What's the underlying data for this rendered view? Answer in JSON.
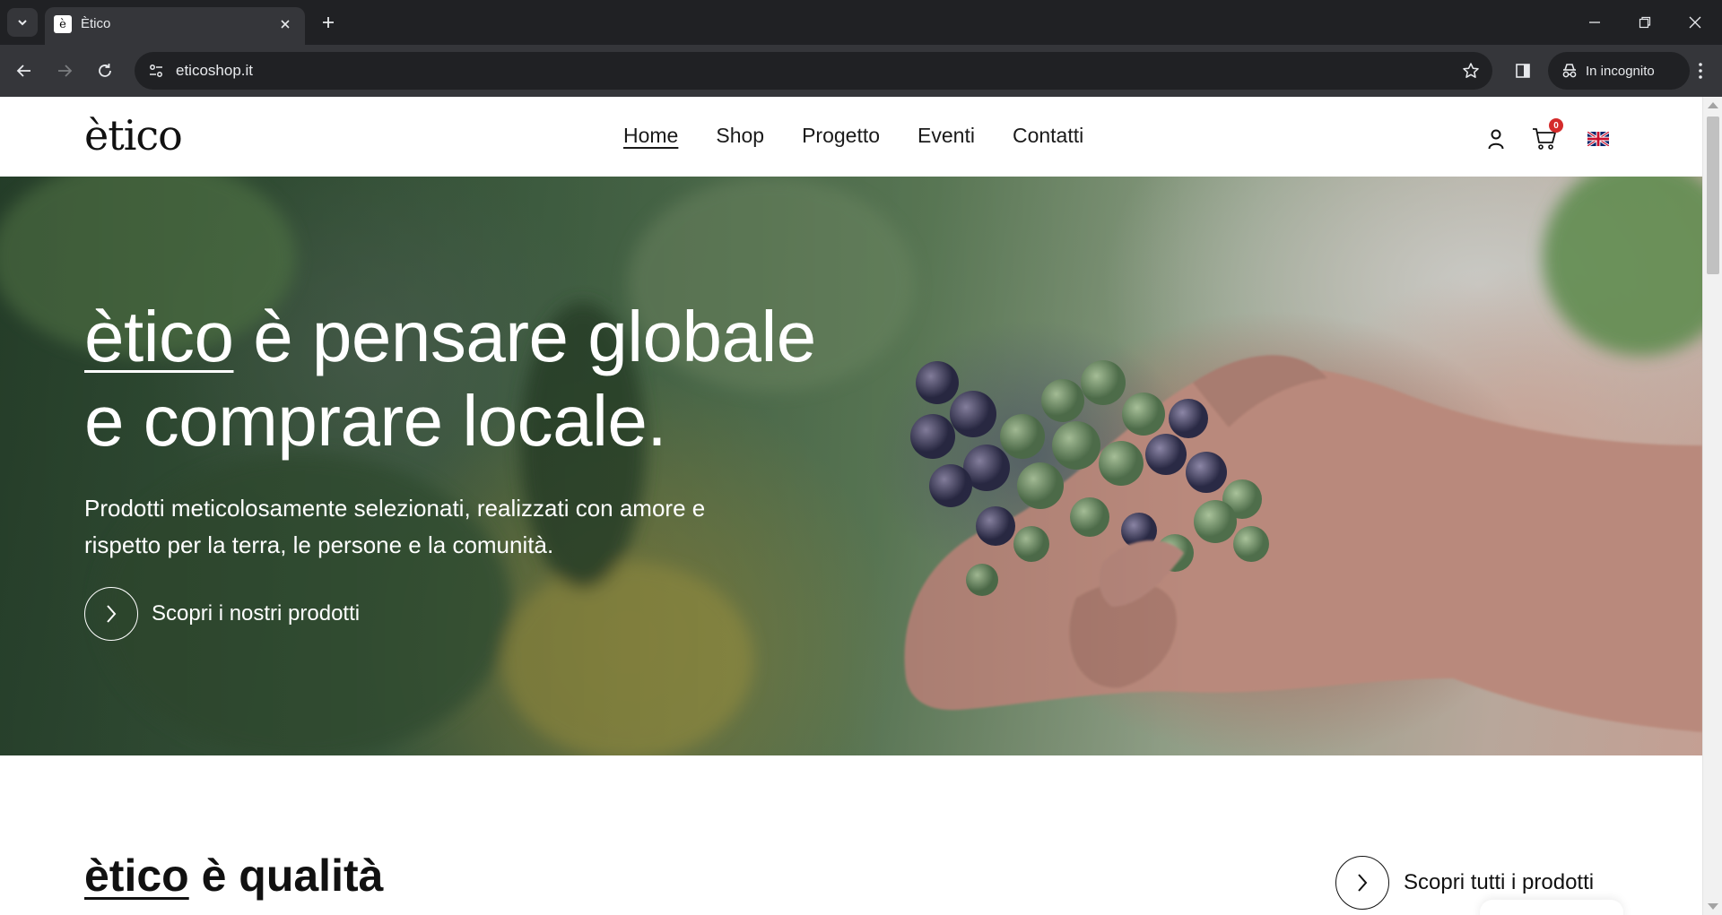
{
  "browser": {
    "tab_title": "Ètico",
    "tab_favicon_letter": "è",
    "url": "eticoshop.it",
    "incognito_label": "In incognito"
  },
  "site": {
    "logo": "ètico",
    "nav": [
      {
        "label": "Home",
        "active": true
      },
      {
        "label": "Shop",
        "active": false
      },
      {
        "label": "Progetto",
        "active": false
      },
      {
        "label": "Eventi",
        "active": false
      },
      {
        "label": "Contatti",
        "active": false
      }
    ],
    "cart_count": "0",
    "language_icon": "uk-flag-icon"
  },
  "hero": {
    "title_brand": "ètico",
    "title_line1_rest": " è pensare globale",
    "title_line2": "e comprare locale.",
    "subtitle": "Prodotti meticolosamente selezionati, realizzati con amore e rispetto per la terra, le persone e la comunità.",
    "cta_label": "Scopri i nostri prodotti"
  },
  "section": {
    "title_brand": "ètico",
    "title_rest": " è qualità",
    "cta_label": "Scopri tutti i prodotti"
  },
  "colors": {
    "browser_frame": "#202124",
    "browser_toolbar": "#35363a",
    "text_dark": "#111111",
    "cart_badge": "#d42b2b"
  }
}
